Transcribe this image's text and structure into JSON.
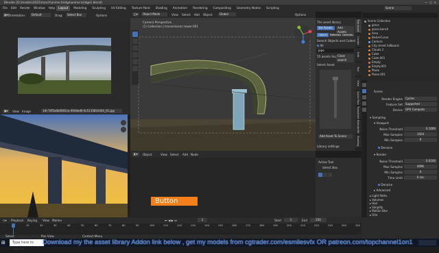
{
  "titlebar": {
    "title": "Blender [D:\\models\\2022\\march\\anime bridge\\anime bridge1.blend]"
  },
  "menubar": {
    "items": [
      "File",
      "Edit",
      "Render",
      "Window",
      "Help"
    ],
    "workspaces": [
      "Layout",
      "Modeling",
      "Sculpting",
      "UV Editing",
      "Texture Paint",
      "Shading",
      "Animation",
      "Rendering",
      "Compositing",
      "Geometry Nodes",
      "Scripting"
    ],
    "scene": "Scene"
  },
  "left_top": {
    "orientation": "Orientation:",
    "default": "Default",
    "drag": "Drag:",
    "select_box": "Select Box",
    "options": "Options"
  },
  "image_editor": {
    "view": "View",
    "image": "Image",
    "filename": "1d\\-74f5a6b0002ca-49d4ed6-0c5133810444_01.jpg"
  },
  "viewport": {
    "mode": "Object Mode",
    "menus": [
      "View",
      "Select",
      "Add",
      "Object"
    ],
    "transform": "Global",
    "info1": "Camera Perspective",
    "info2": "(1) Collection | transmission tower.001",
    "options": "Options"
  },
  "asset_panel": {
    "title": "The asset library",
    "set_assets": "Set Assets",
    "add_assets": "Add Assets",
    "tabs": [
      "Objects",
      "Materials",
      "Collectio..."
    ],
    "search_label": "Search Objects and Collection",
    "all": "All",
    "search_value": "pipe",
    "found": "55 assets fou..",
    "close_search": "Close search",
    "select_asset": "Select Asset",
    "add_asset_btn": "Add Asset To Scene",
    "library_settings": "Library settings"
  },
  "side_tabs": [
    "The asset li..",
    "Create",
    "Edit",
    "Tool",
    "View",
    "Quick Favo",
    "Transform",
    "BlenderKit",
    "Shading"
  ],
  "timeline_mid": {
    "object": "Object",
    "view": "View",
    "select": "Select",
    "add": "Add",
    "node": "Node"
  },
  "active_tool": {
    "title": "Active Tool",
    "select_box": "Select Box"
  },
  "outliner": {
    "search_placeholder": "",
    "items": [
      "Scene Collection",
      "grass",
      "grass.bench",
      "Area",
      "BezierCurve",
      "Camera",
      "City street billboard.",
      "Clouds 2",
      "Cube",
      "Cube.001",
      "Empty",
      "Empty.001",
      "Plane",
      "Plane.001"
    ],
    "dot_colors": [
      "#9aa0a6",
      "#9aa0a6",
      "#e0853f",
      "#e0853f",
      "#e0853f",
      "#6db1ff",
      "#e0853f",
      "#e0853f",
      "#e0853f",
      "#e0853f",
      "#e0853f",
      "#e0853f",
      "#e0853f",
      "#e0853f"
    ]
  },
  "properties": {
    "scene": "Scene",
    "render_engine_label": "Render Engine",
    "render_engine": "Cycles",
    "feature_set_label": "Feature Set",
    "feature_set": "Supported",
    "device_label": "Device",
    "device": "GPU Compute",
    "sampling": "Sampling",
    "viewport": "Viewport",
    "noise_threshold_label": "Noise Threshold",
    "noise_threshold": "0.1000",
    "max_samples_label": "Max Samples",
    "max_samples": "1024",
    "min_samples_label": "Min Samples",
    "min_samples": "0",
    "denoise": "Denoise",
    "render": "Render",
    "noise_threshold2": "0.0100",
    "max_samples2": "4096",
    "min_samples2": "0",
    "time_limit_label": "Time Limit",
    "time_limit": "0 sec",
    "denoise2": "Denoise",
    "advanced": "Advanced",
    "sections": [
      "Light Paths",
      "Volumes",
      "Hair",
      "Simplify",
      "Motion Blur",
      "Film"
    ]
  },
  "timeline": {
    "playback": "Playback",
    "keying": "Keying",
    "view": "View",
    "marker": "Marker",
    "start_label": "Start",
    "start": "1",
    "end_label": "End",
    "end": "250",
    "current": "1",
    "ticks": [
      "0",
      "10",
      "20",
      "30",
      "40",
      "50",
      "60",
      "70",
      "80",
      "90",
      "100",
      "110",
      "120",
      "130",
      "140",
      "150",
      "160",
      "170",
      "180",
      "190",
      "200",
      "210",
      "220",
      "230",
      "240",
      "250"
    ]
  },
  "statusbar": {
    "left": "Select",
    "mid": "Pan View",
    "right": "Context Menu"
  },
  "overlay_button": "Button",
  "taskbar": {
    "search_placeholder": "Type here to search"
  },
  "caption": "Download my the asset library Addon  link below ,  get my models from cgtrader.com/esmilesvfx OR patreon.com/topchannel1on1"
}
